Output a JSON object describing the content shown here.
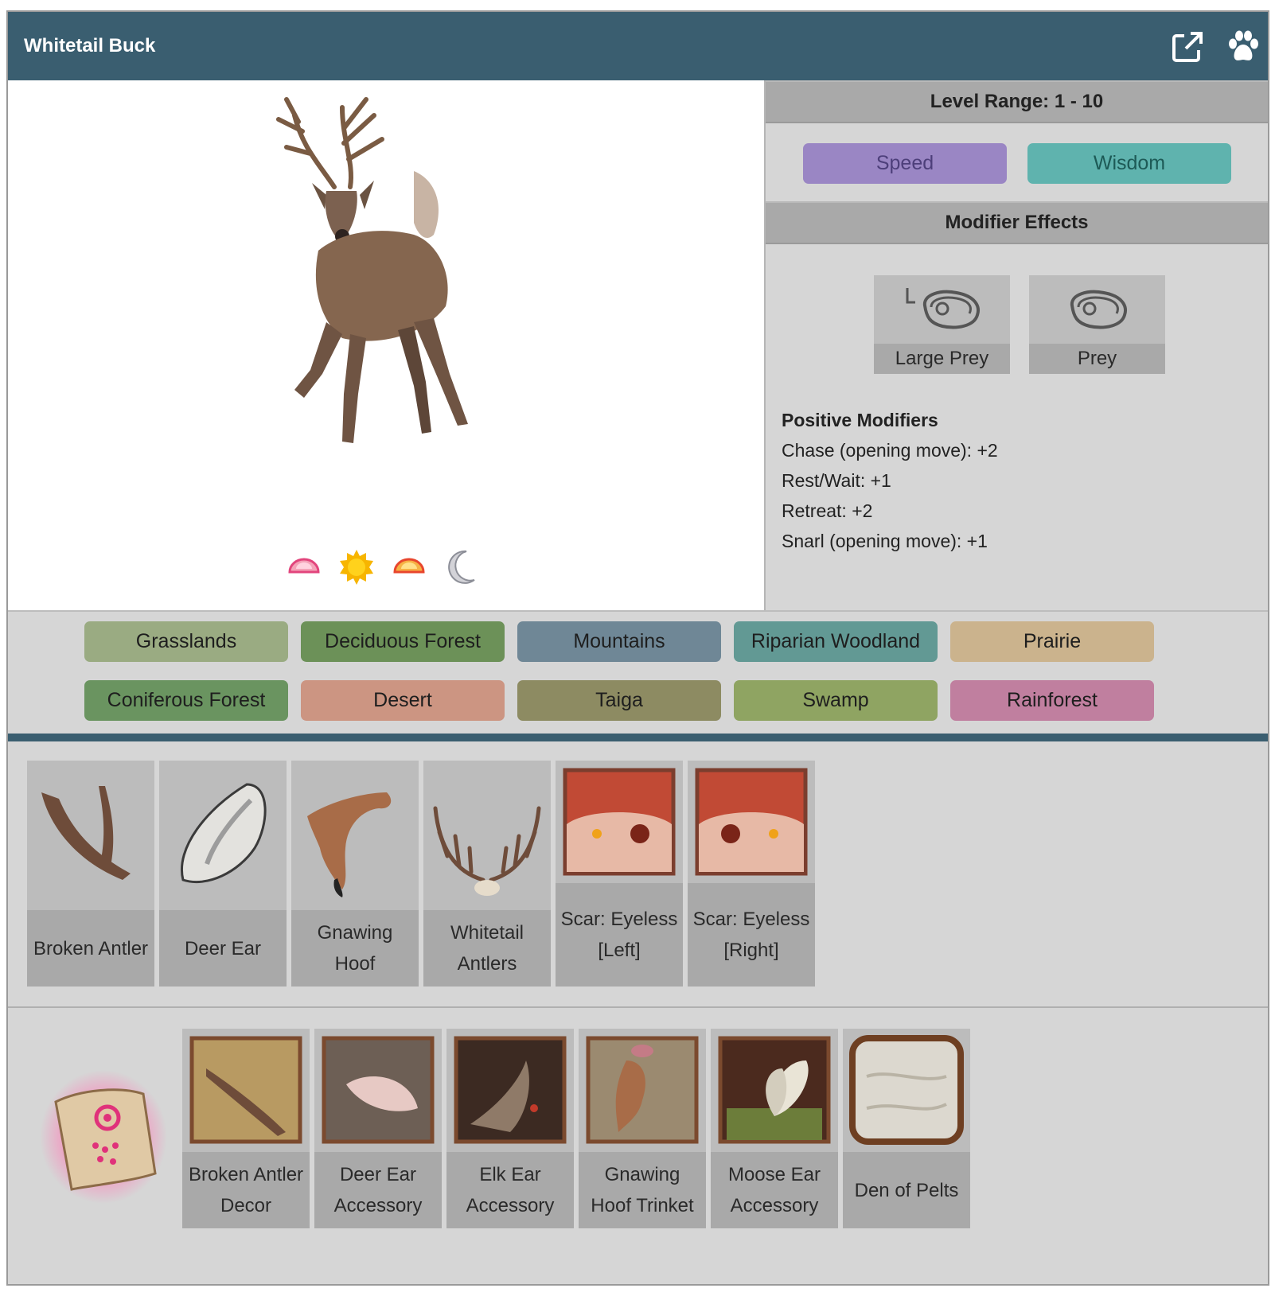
{
  "header": {
    "title": "Whitetail Buck",
    "icons": [
      "external-link-icon",
      "paw-icon"
    ]
  },
  "level_range": "Level Range: 1 - 10",
  "stats": [
    "Speed",
    "Wisdom"
  ],
  "modifier_effects_title": "Modifier Effects",
  "effects": [
    "Large Prey",
    "Prey"
  ],
  "positive_modifiers": {
    "heading": "Positive Modifiers",
    "items": [
      "Chase (opening move): +2",
      "Rest/Wait: +1",
      "Retreat: +2",
      "Snarl (opening move): +1"
    ]
  },
  "time_of_day_icons": [
    "dawn-icon",
    "sun-icon",
    "dusk-icon",
    "moon-icon"
  ],
  "biomes": [
    {
      "label": "Grasslands",
      "color": "#9aab82"
    },
    {
      "label": "Deciduous Forest",
      "color": "#6c9158"
    },
    {
      "label": "Mountains",
      "color": "#6f8796"
    },
    {
      "label": "Riparian Woodland",
      "color": "#629994"
    },
    {
      "label": "Prairie",
      "color": "#cbb38d"
    },
    {
      "label": "Coniferous Forest",
      "color": "#6a9460"
    },
    {
      "label": "Desert",
      "color": "#cc9582"
    },
    {
      "label": "Taiga",
      "color": "#8d8b62"
    },
    {
      "label": "Swamp",
      "color": "#8fa462"
    },
    {
      "label": "Rainforest",
      "color": "#c07f9f"
    }
  ],
  "drops": [
    {
      "name": "Broken Antler"
    },
    {
      "name": "Deer Ear"
    },
    {
      "name": "Gnawing Hoof"
    },
    {
      "name": "Whitetail Antlers"
    },
    {
      "name": "Scar: Eyeless [Left]"
    },
    {
      "name": "Scar: Eyeless [Right]"
    }
  ],
  "decor": [
    {
      "name": "Broken Antler Decor"
    },
    {
      "name": "Deer Ear Accessory"
    },
    {
      "name": "Elk Ear Accessory"
    },
    {
      "name": "Gnawing Hoof Trinket"
    },
    {
      "name": "Moose Ear Accessory"
    },
    {
      "name": "Den of Pelts"
    }
  ]
}
